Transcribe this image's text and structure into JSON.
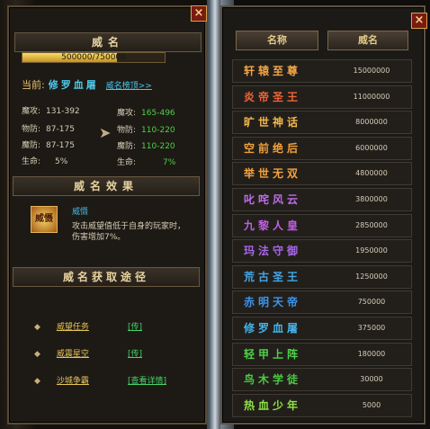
{
  "left_panel": {
    "title": "威名",
    "progress_text": "500000/750000",
    "progress_value": 0.667,
    "current_label": "当前:",
    "current_name": "修罗血屠",
    "table_link": "威名榜顶>>",
    "stats_left": [
      {
        "label": "魔攻:",
        "value": "131-392"
      },
      {
        "label": "物防:",
        "value": "87-175"
      },
      {
        "label": "魔防:",
        "value": "87-175"
      },
      {
        "label": "生命:",
        "value": "5%"
      }
    ],
    "stats_right": [
      {
        "label": "魔攻:",
        "value": "165-496"
      },
      {
        "label": "物防:",
        "value": "110-220"
      },
      {
        "label": "魔防:",
        "value": "110-220"
      },
      {
        "label": "生命:",
        "value": "7%"
      }
    ],
    "effect_title": "威名效果",
    "skill_icon_text": "威慑",
    "skill_name": "威慑",
    "skill_desc": "攻击威望值低于自身的玩家时，伤害增加7%。",
    "acquire_title": "威名获取途径",
    "routes": [
      {
        "name": "威望任务",
        "btn": "[传]"
      },
      {
        "name": "威震星空",
        "btn": "[传]"
      },
      {
        "name": "沙城争霸",
        "btn": "[查看详情]"
      }
    ]
  },
  "right_panel": {
    "col_name": "名称",
    "col_value": "威名",
    "rows": [
      {
        "title": "轩辕至尊",
        "score": "15000000",
        "color": "#f3a545"
      },
      {
        "title": "炎帝圣王",
        "score": "11000000",
        "color": "#f06436"
      },
      {
        "title": "旷世神话",
        "score": "8000000",
        "color": "#f1b64a"
      },
      {
        "title": "空前绝后",
        "score": "6000000",
        "color": "#f2a03a"
      },
      {
        "title": "举世无双",
        "score": "4800000",
        "color": "#f5a23c"
      },
      {
        "title": "叱咤风云",
        "score": "3800000",
        "color": "#bd6dea"
      },
      {
        "title": "九黎人皇",
        "score": "2850000",
        "color": "#c25ee6"
      },
      {
        "title": "玛法守御",
        "score": "1950000",
        "color": "#a766e9"
      },
      {
        "title": "荒古圣王",
        "score": "1250000",
        "color": "#45a6e6"
      },
      {
        "title": "赤明天帝",
        "score": "750000",
        "color": "#3e95e8"
      },
      {
        "title": "修罗血屠",
        "score": "375000",
        "color": "#43b4ea"
      },
      {
        "title": "轻甲上阵",
        "score": "180000",
        "color": "#4fd14a"
      },
      {
        "title": "鸟木学徒",
        "score": "30000",
        "color": "#4cc944"
      },
      {
        "title": "热血少年",
        "score": "5000",
        "color": "#8fe24a"
      }
    ]
  },
  "close_icon": "×"
}
